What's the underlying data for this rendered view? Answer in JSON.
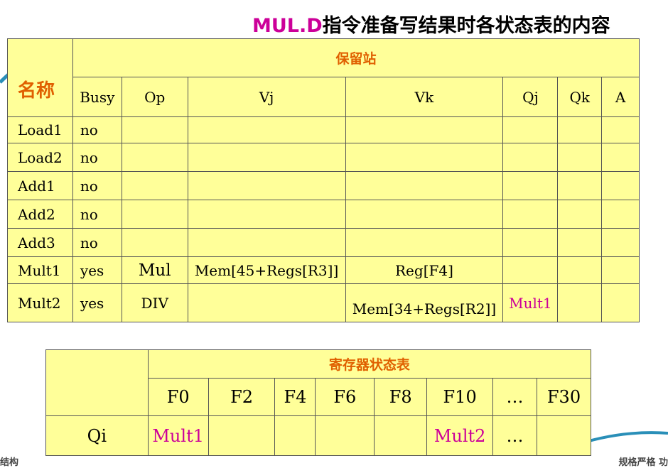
{
  "title": {
    "accent": "MUL.D",
    "rest": "指令准备写结果时各状态表的内容"
  },
  "rs": {
    "name_header": "名称",
    "group_header": "保留站",
    "columns": [
      "Busy",
      "Op",
      "Vj",
      "Vk",
      "Qj",
      "Qk",
      "A"
    ],
    "rows": [
      {
        "name": "Load1",
        "busy": "no",
        "op": "",
        "vj": "",
        "vk": "",
        "qj": "",
        "qk": "",
        "a": ""
      },
      {
        "name": "Load2",
        "busy": "no",
        "op": "",
        "vj": "",
        "vk": "",
        "qj": "",
        "qk": "",
        "a": ""
      },
      {
        "name": "Add1",
        "busy": "no",
        "op": "",
        "vj": "",
        "vk": "",
        "qj": "",
        "qk": "",
        "a": ""
      },
      {
        "name": "Add2",
        "busy": "no",
        "op": "",
        "vj": "",
        "vk": "",
        "qj": "",
        "qk": "",
        "a": ""
      },
      {
        "name": "Add3",
        "busy": "no",
        "op": "",
        "vj": "",
        "vk": "",
        "qj": "",
        "qk": "",
        "a": ""
      },
      {
        "name": "Mult1",
        "busy": "yes",
        "op": "Mul",
        "vj": "Mem[45+Regs[R3]]",
        "vk": "Reg[F4]",
        "qj": "",
        "qk": "",
        "a": ""
      },
      {
        "name": "Mult2",
        "busy": "yes",
        "op": "DIV",
        "vj": "",
        "vk": "Mem[34+Regs[R2]]",
        "qj": "Mult1",
        "qk": "",
        "a": ""
      }
    ]
  },
  "reg": {
    "group_header": "寄存器状态表",
    "columns": [
      "F0",
      "F2",
      "F4",
      "F6",
      "F8",
      "F10",
      "…",
      "F30"
    ],
    "row_label": "Qi",
    "values": [
      "Mult1",
      "",
      "",
      "",
      "",
      "Mult2",
      "…",
      ""
    ]
  },
  "footer": {
    "left": "结构",
    "right": "规格严格 功"
  },
  "colors": {
    "table_bg": "#ffff99",
    "header_orange": "#e06000",
    "magenta": "#cc0099"
  }
}
